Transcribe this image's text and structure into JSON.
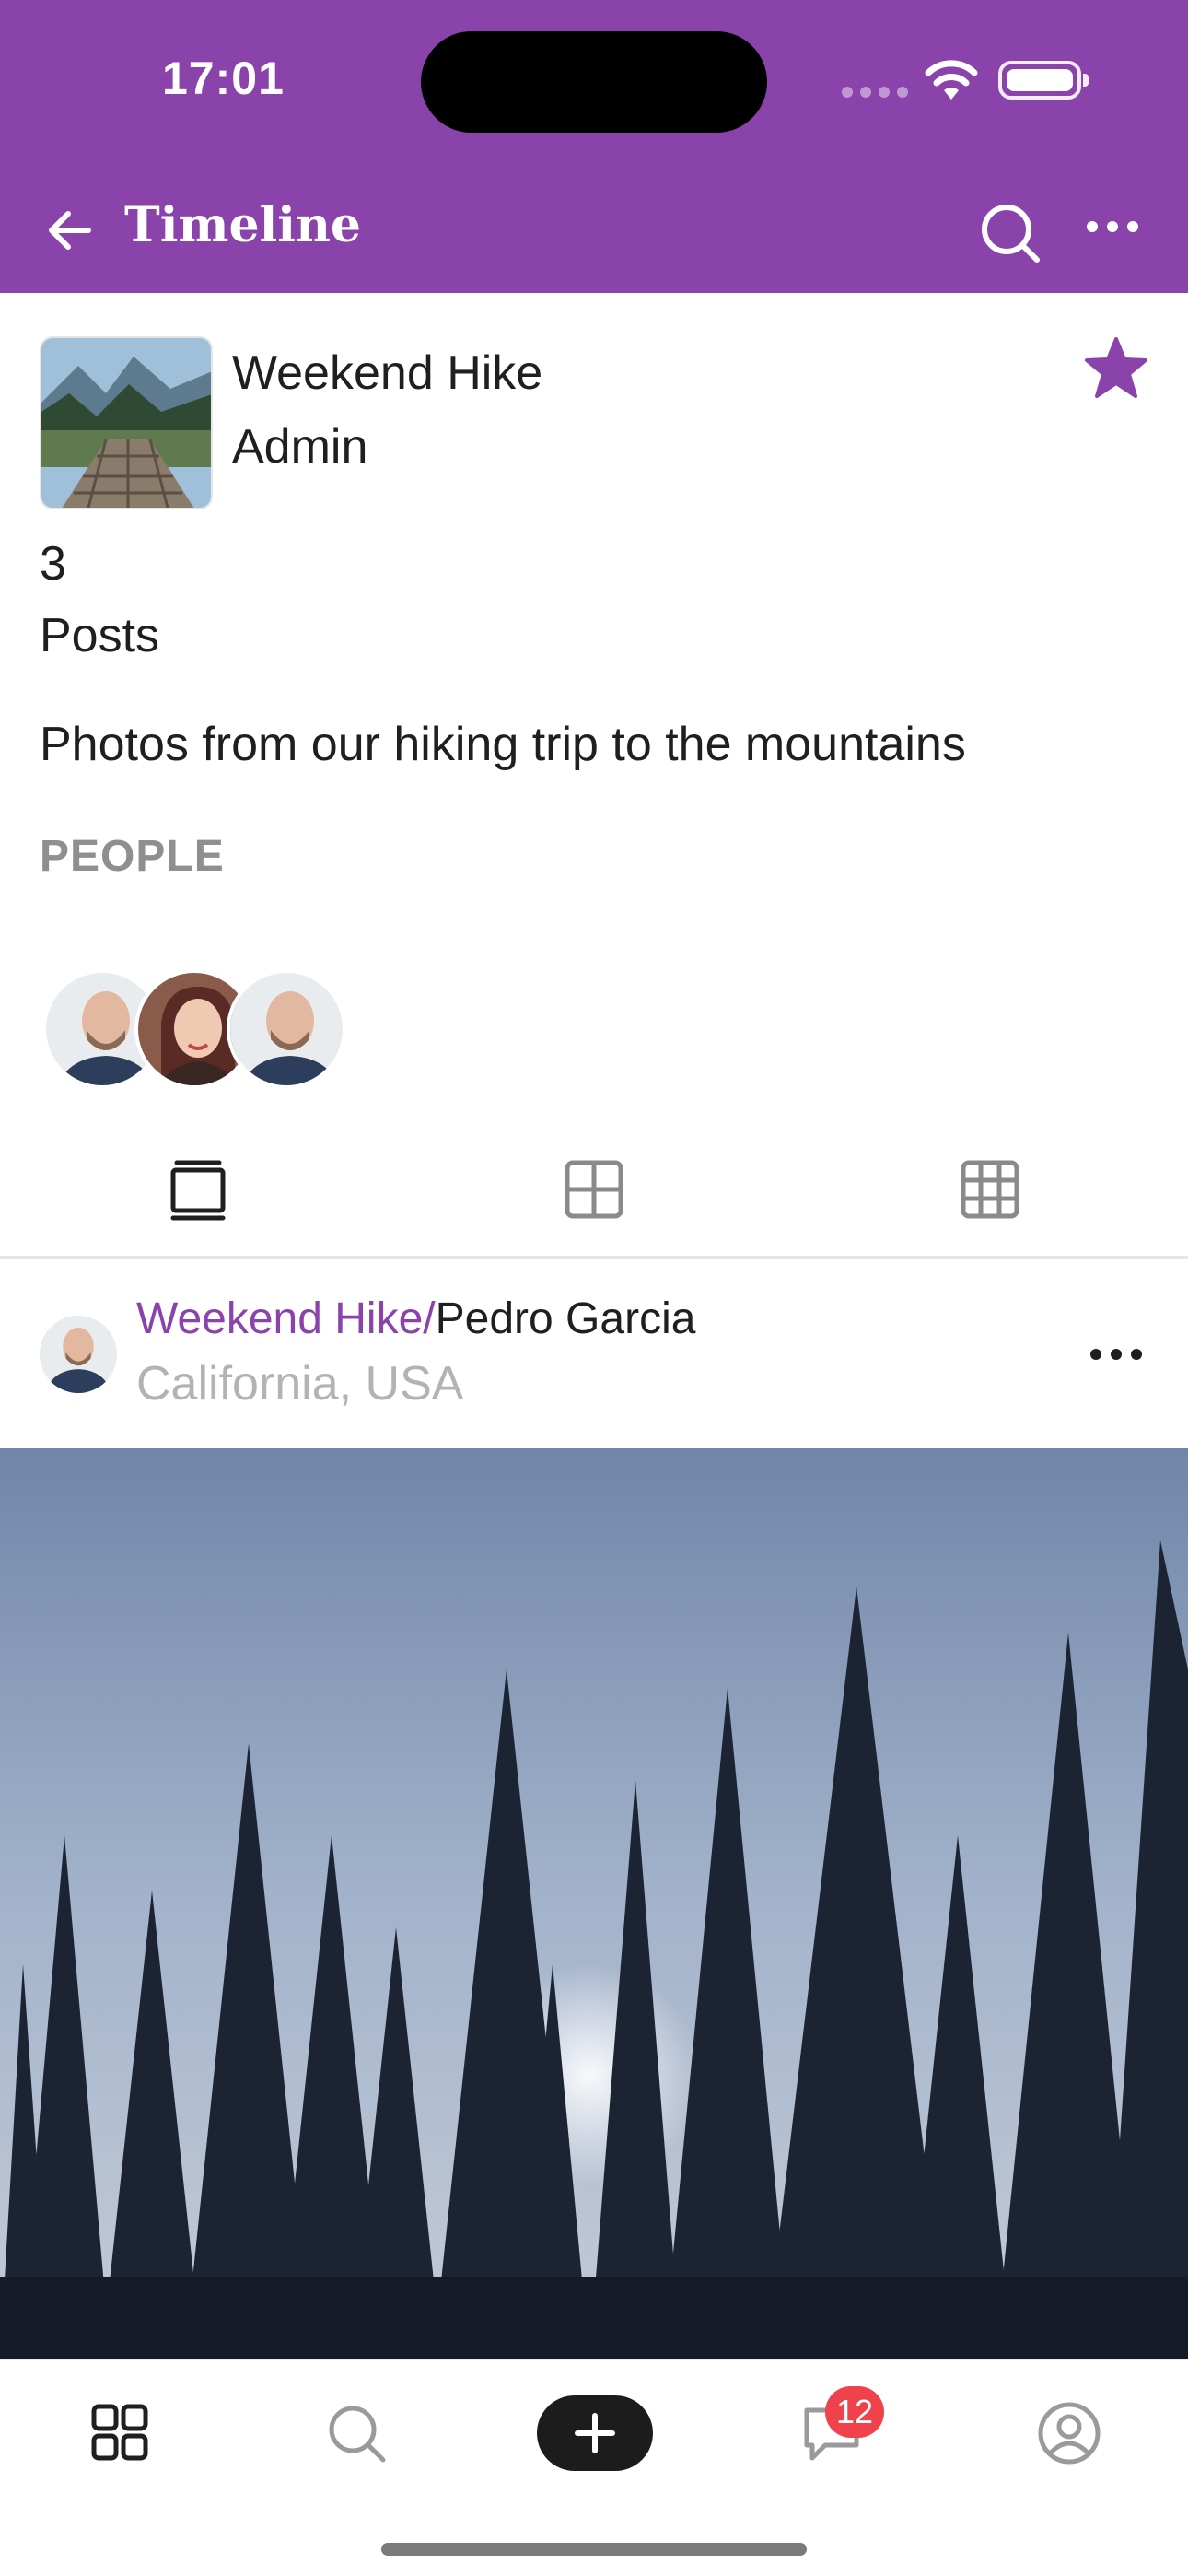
{
  "status_bar": {
    "time": "17:01"
  },
  "header": {
    "title": "Timeline",
    "back_icon": "arrow-left-icon",
    "search_icon": "search-icon",
    "more_icon": "more-horizontal-icon",
    "background": "#8a43ab"
  },
  "group": {
    "name": "Weekend Hike",
    "role": "Admin",
    "posts_count": "3",
    "posts_label": "Posts",
    "description": "Photos from our hiking trip to the mountains",
    "people_label": "PEOPLE",
    "favorite_icon": "star-icon",
    "accent": "#8a43ab"
  },
  "people": [
    {
      "avatar": "man-avatar"
    },
    {
      "avatar": "woman-avatar"
    },
    {
      "avatar": "man-avatar"
    }
  ],
  "view_tabs": [
    {
      "icon": "single-view-icon",
      "active": true
    },
    {
      "icon": "grid-2x2-icon",
      "active": false
    },
    {
      "icon": "grid-3x3-icon",
      "active": false
    }
  ],
  "post": {
    "group": "Weekend Hike",
    "separator": "/",
    "author": "Pedro Garcia",
    "location": "California, USA",
    "more_icon": "more-horizontal-icon",
    "image": "forest-photo"
  },
  "bottom_nav": {
    "items": [
      {
        "icon": "dashboard-icon"
      },
      {
        "icon": "search-icon"
      },
      {
        "icon": "add-icon"
      },
      {
        "icon": "messages-icon",
        "badge": "12"
      },
      {
        "icon": "profile-icon"
      }
    ],
    "badge_color": "#f0424b"
  }
}
